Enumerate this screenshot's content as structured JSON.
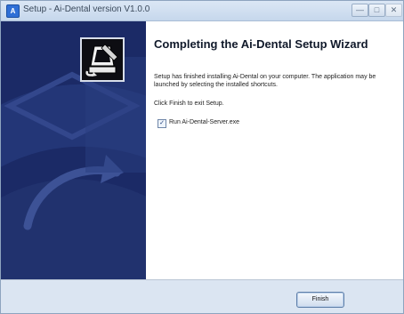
{
  "window": {
    "title": "Setup - Ai-Dental version V1.0.0",
    "app_icon_glyph": "A",
    "controls": {
      "minimize": "—",
      "maximize": "□",
      "close": "✕"
    }
  },
  "wizard": {
    "heading": "Completing the Ai-Dental Setup Wizard",
    "message": "Setup has finished installing Ai-Dental on your computer. The application may be launched by selecting the installed shortcuts.",
    "finish_note": "Click Finish to exit Setup.",
    "run_option": {
      "label": "Run Ai-Dental-Server.exe",
      "checked": true,
      "check_glyph": "✓"
    }
  },
  "footer": {
    "finish_label": "Finish"
  },
  "colors": {
    "banner": "#1b2a66",
    "accent": "#2f6fd6"
  },
  "icons": [
    "app-icon",
    "minimize-icon",
    "maximize-icon",
    "close-icon",
    "setup-logo-icon",
    "checkmark-icon"
  ]
}
